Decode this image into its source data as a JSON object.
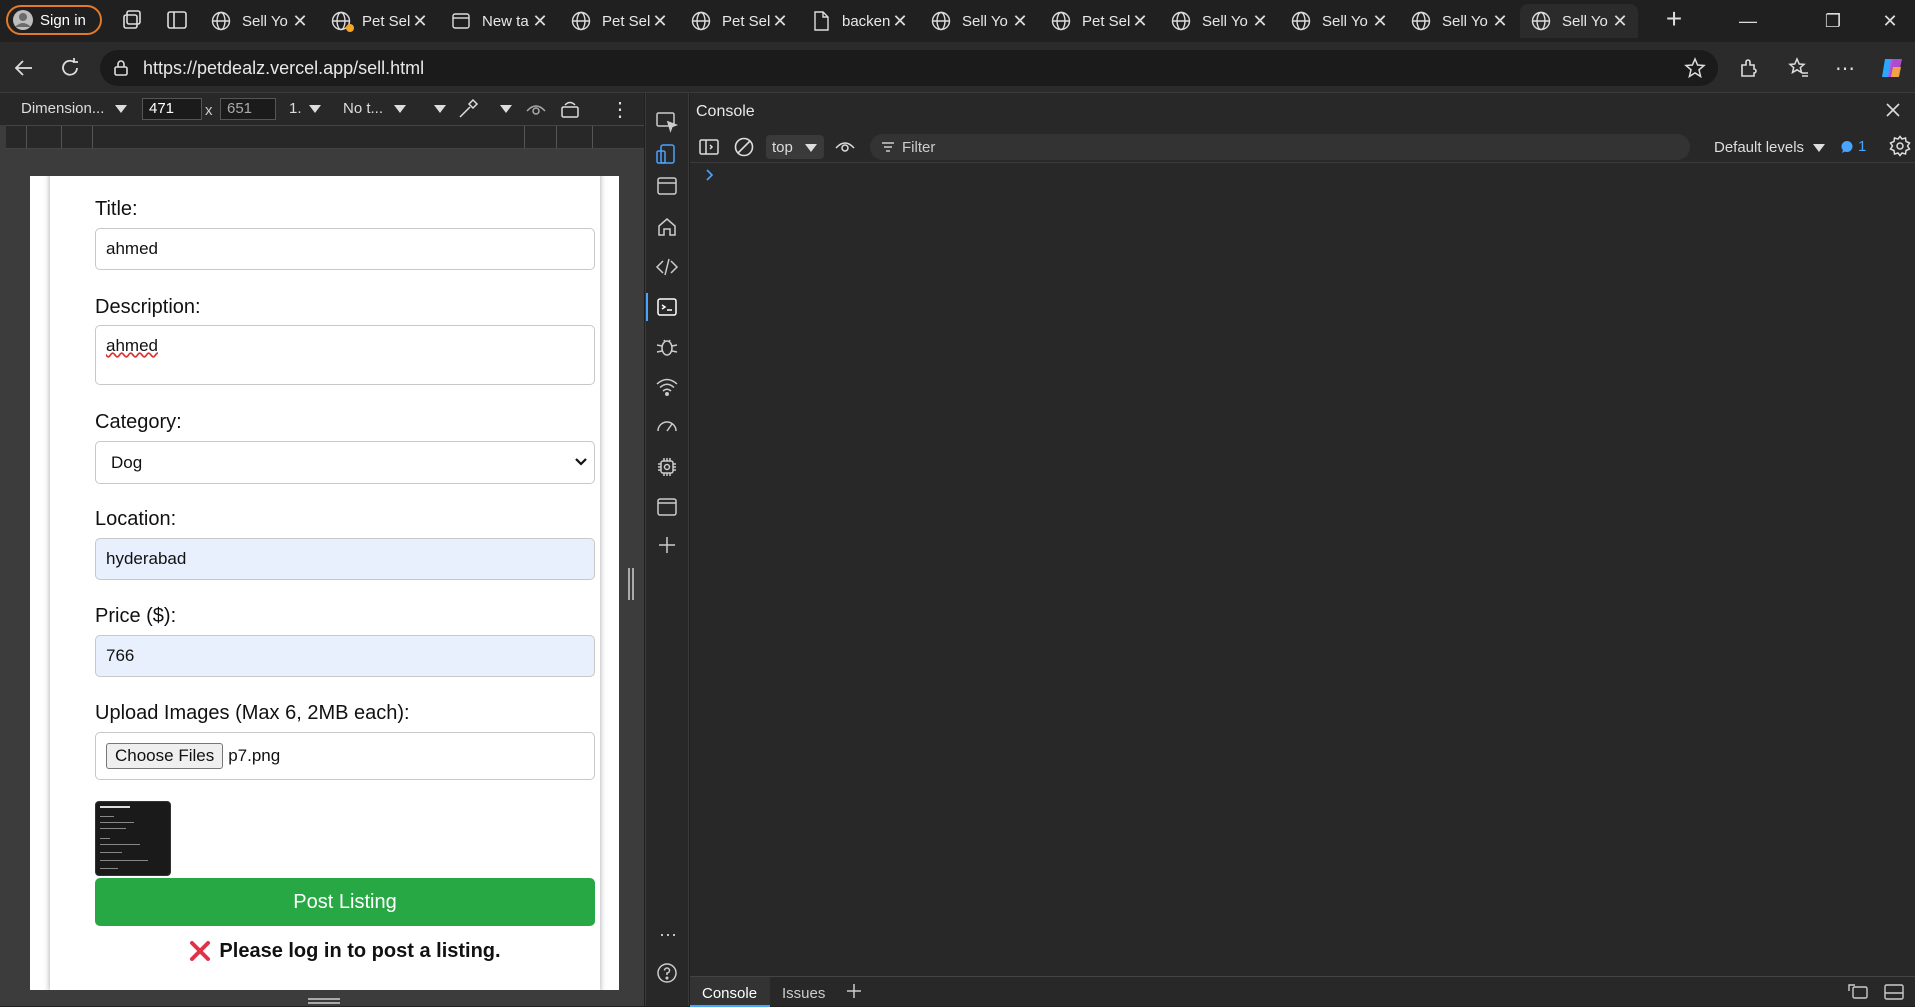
{
  "browser": {
    "sign_in": "Sign in",
    "url": "https://petdealz.vercel.app/sell.html",
    "tabs": [
      {
        "label": "Sell Yo",
        "icon": "globe-icon"
      },
      {
        "label": "Pet Sel",
        "icon": "globe-icon"
      },
      {
        "label": "New ta",
        "icon": "newtab-icon"
      },
      {
        "label": "Pet Sel",
        "icon": "globe-icon"
      },
      {
        "label": "Pet Sel",
        "icon": "globe-icon"
      },
      {
        "label": "backen",
        "icon": "file-icon"
      },
      {
        "label": "Sell Yo",
        "icon": "globe-icon"
      },
      {
        "label": "Pet Sel",
        "icon": "globe-icon"
      },
      {
        "label": "Sell Yo",
        "icon": "globe-icon"
      },
      {
        "label": "Sell Yo",
        "icon": "globe-icon"
      },
      {
        "label": "Sell Yo",
        "icon": "globe-icon"
      },
      {
        "label": "Sell Yo",
        "icon": "globe-icon"
      }
    ]
  },
  "device_toolbar": {
    "dimensions": "Dimension...",
    "width": "471",
    "times": "x",
    "height": "651",
    "zoom": "1.",
    "throttle": "No t..."
  },
  "form": {
    "title_label": "Title:",
    "title_value": "ahmed",
    "description_label": "Description:",
    "description_value": "ahmed",
    "category_label": "Category:",
    "category_value": "Dog",
    "location_label": "Location:",
    "location_value": "hyderabad",
    "price_label": "Price ($):",
    "price_value": "766",
    "upload_label": "Upload Images (Max 6, 2MB each):",
    "choose_files": "Choose Files",
    "file_name": "p7.png",
    "post_button": "Post Listing",
    "error_message": "Please log in to post a listing.",
    "button_color": "#28a745",
    "error_color": "#e0334a"
  },
  "devtools": {
    "panel_title": "Console",
    "context": "top",
    "filter_placeholder": "Filter",
    "levels": "Default levels",
    "issues_count": "1",
    "bottom_tabs": [
      "Console",
      "Issues"
    ]
  }
}
